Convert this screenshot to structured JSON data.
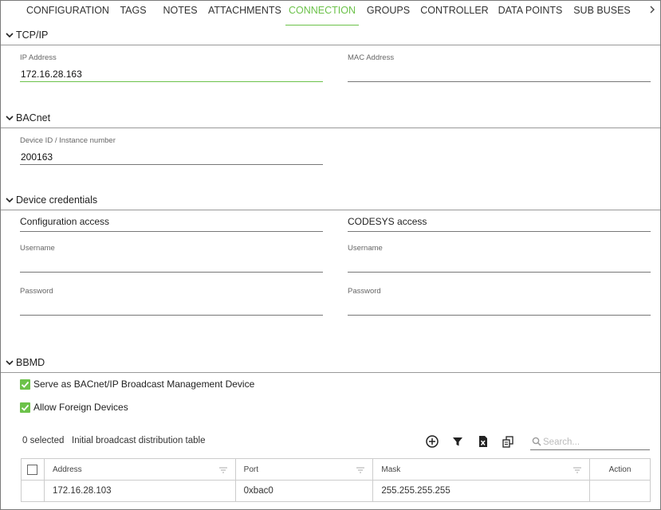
{
  "tabs": [
    {
      "label": "CONFIGURATION",
      "active": false
    },
    {
      "label": "TAGS",
      "active": false
    },
    {
      "label": "NOTES",
      "active": false
    },
    {
      "label": "ATTACHMENTS",
      "active": false
    },
    {
      "label": "CONNECTION",
      "active": true
    },
    {
      "label": "GROUPS",
      "active": false
    },
    {
      "label": "CONTROLLER",
      "active": false
    },
    {
      "label": "DATA POINTS",
      "active": false
    },
    {
      "label": "SUB BUSES",
      "active": false
    }
  ],
  "colors": {
    "accent": "#6cc24a"
  },
  "tcpip": {
    "title": "TCP/IP",
    "ip_label": "IP Address",
    "ip_value": "172.16.28.163",
    "mac_label": "MAC Address",
    "mac_value": ""
  },
  "bacnet": {
    "title": "BACnet",
    "device_label": "Device ID / Instance number",
    "device_value": "200163"
  },
  "credentials": {
    "title": "Device credentials",
    "config": {
      "heading": "Configuration access",
      "username_label": "Username",
      "username_value": "",
      "password_label": "Password",
      "password_value": ""
    },
    "codesys": {
      "heading": "CODESYS access",
      "username_label": "Username",
      "username_value": "",
      "password_label": "Password",
      "password_value": ""
    }
  },
  "bbmd": {
    "title": "BBMD",
    "serve_label": "Serve as BACnet/IP Broadcast Management Device",
    "serve_checked": true,
    "foreign_label": "Allow Foreign Devices",
    "foreign_checked": true,
    "selected_text": "0 selected",
    "table_title": "Initial broadcast distribution table",
    "search_placeholder": "Search...",
    "icons": [
      "add-icon",
      "filter-icon",
      "excel-export-icon",
      "copy-icon"
    ],
    "columns": [
      "Address",
      "Port",
      "Mask",
      "Action"
    ],
    "rows": [
      {
        "address": "172.16.28.103",
        "port": "0xbac0",
        "mask": "255.255.255.255",
        "action": ""
      }
    ]
  }
}
